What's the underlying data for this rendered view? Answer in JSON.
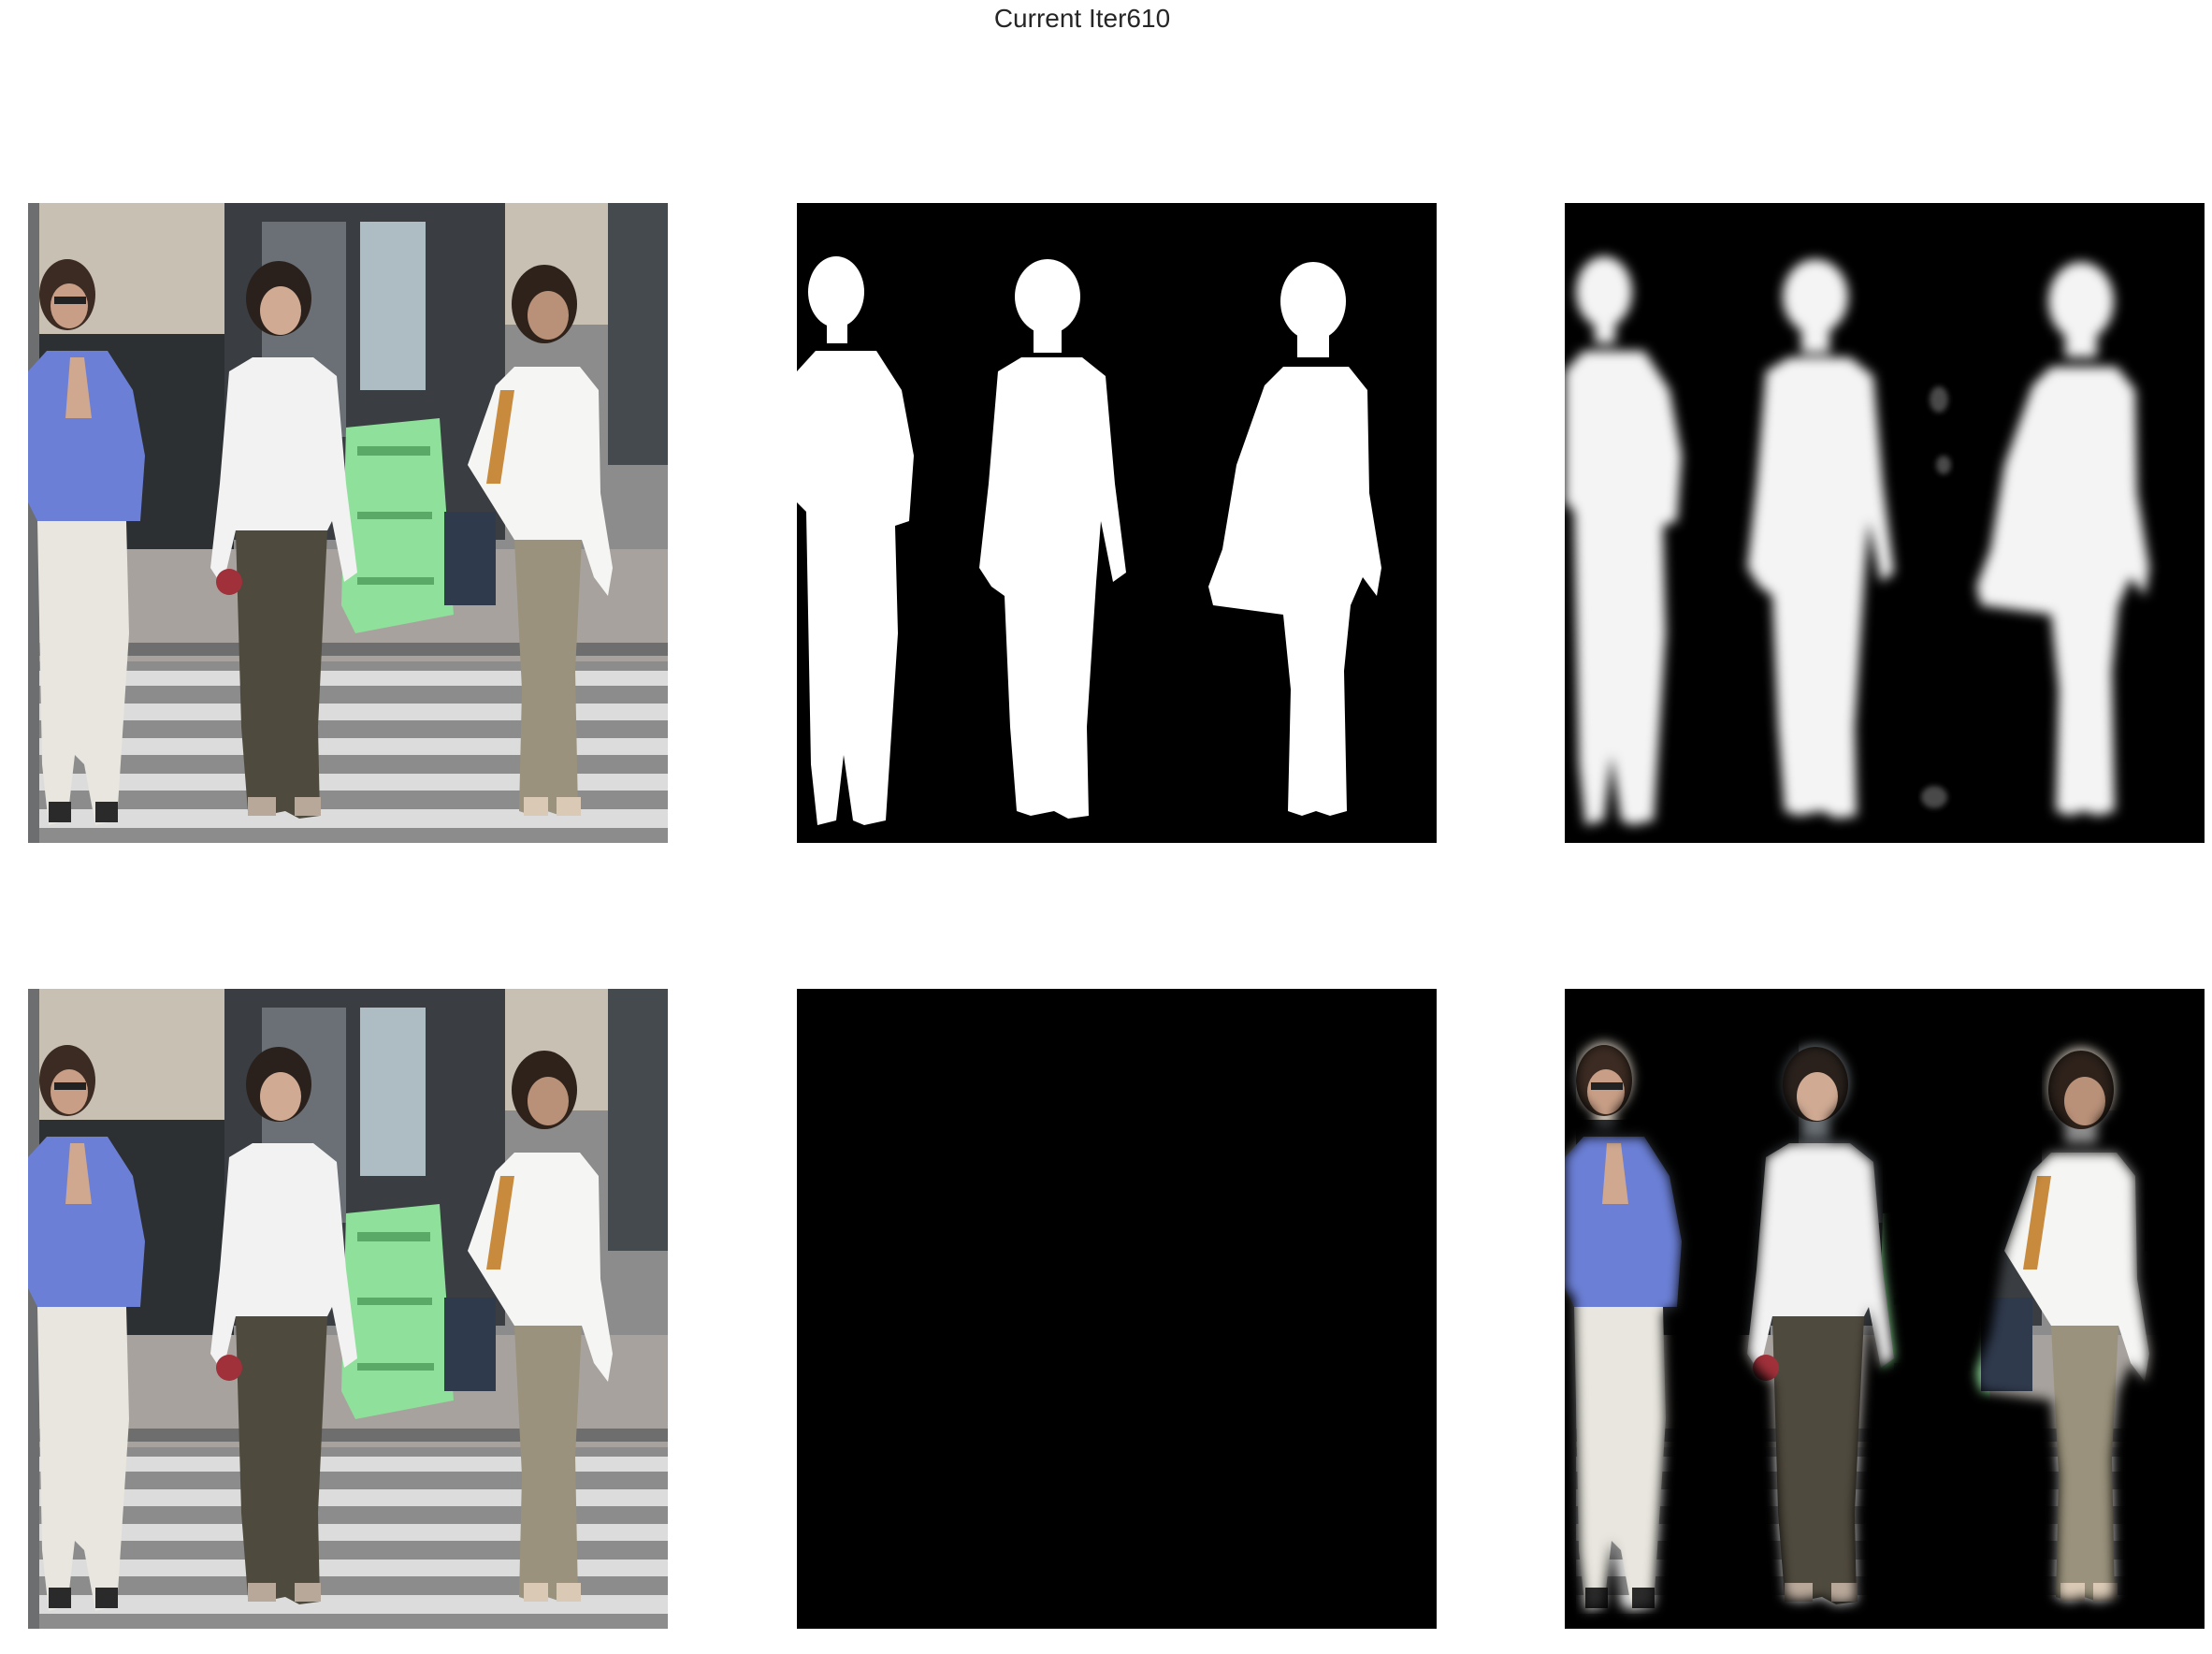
{
  "figure": {
    "title": "Current Iter610"
  },
  "panels": [
    {
      "row": 1,
      "col": 1,
      "kind": "input-image",
      "icon": "street-scene-photo"
    },
    {
      "row": 1,
      "col": 2,
      "kind": "ground-truth-mask",
      "icon": "binary-silhouette-mask"
    },
    {
      "row": 1,
      "col": 3,
      "kind": "predicted-mask",
      "icon": "soft-silhouette-mask"
    },
    {
      "row": 2,
      "col": 1,
      "kind": "input-image",
      "icon": "street-scene-photo"
    },
    {
      "row": 2,
      "col": 2,
      "kind": "ground-truth-masked-image",
      "icon": "masked-photo"
    },
    {
      "row": 2,
      "col": 3,
      "kind": "predicted-masked-image",
      "icon": "soft-masked-photo"
    }
  ],
  "colors": {
    "background": "#ffffff",
    "mask_black": "#000000",
    "mask_white": "#ffffff",
    "shirt_blue": "#6b7fd6",
    "shirt_white": "#f2f2f2",
    "pants_khaki": "#9a927c",
    "pants_dark": "#4f4a3e",
    "pants_white": "#e8e6de",
    "bin_green": "#8fe09a",
    "crosswalk": "#d9d9d9",
    "road": "#8c8c8c",
    "wall_beige": "#c9c0b4",
    "storefront_dark": "#3a3e42"
  }
}
